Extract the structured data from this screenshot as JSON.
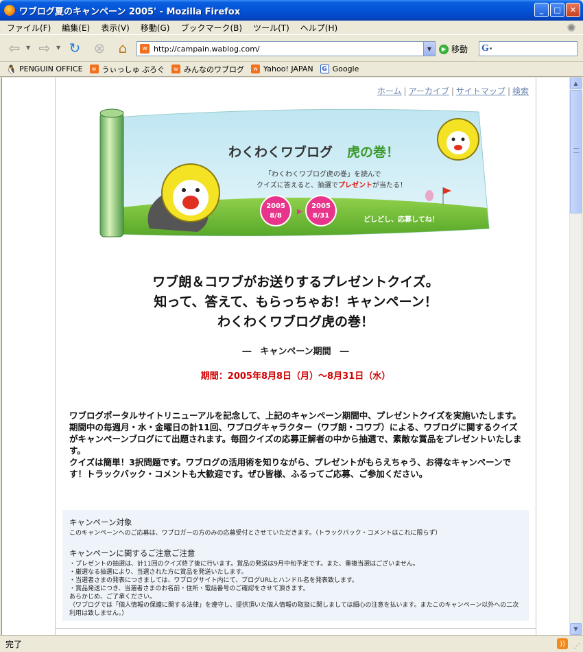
{
  "window": {
    "title": "ワブログ夏のキャンペーン 2005' - Mozilla Firefox",
    "minimize": "_",
    "maximize": "□",
    "close": "✕"
  },
  "menu": {
    "file": "ファイル(F)",
    "edit": "編集(E)",
    "view": "表示(V)",
    "go": "移動(G)",
    "bookmarks": "ブックマーク(B)",
    "tools": "ツール(T)",
    "help": "ヘルプ(H)"
  },
  "nav": {
    "url": "http://campain.wablog.com/",
    "go_label": "移動"
  },
  "bookmarks": [
    {
      "label": "PENGUIN OFFICE"
    },
    {
      "label": "うぃっしゅ ぶろぐ"
    },
    {
      "label": "みんなのワブログ"
    },
    {
      "label": "Yahoo! JAPAN"
    },
    {
      "label": "Google"
    }
  ],
  "toplinks": {
    "home": "ホーム",
    "archive": "アーカイブ",
    "sitemap": "サイトマップ",
    "search": "検索"
  },
  "banner": {
    "title_main": "わくわくワブログ",
    "title_accent": "虎の巻！",
    "desc_line1": "「わくわくワブログ虎の巻」を読んで",
    "desc_line2": "クイズに答えると、抽選で",
    "desc_present": "プレゼント",
    "desc_line2_end": "が当たる！",
    "start_year": "2005",
    "start_date": "8/8",
    "end_year": "2005",
    "end_date": "8/31",
    "tagline": "どしどし、応募してね！"
  },
  "headline": {
    "line1": "ワブ朗＆コワブがお送りするプレゼントクイズ。",
    "line2": "知って、答えて、もらっちゃお！キャンペーン！",
    "line3": "わくわくワブログ虎の巻！"
  },
  "period": {
    "title": "―　キャンペーン期間　―",
    "date": "期間：2005年8月8日（月）～8月31日（水）"
  },
  "intro": {
    "p1": "ワブログポータルサイトリニューアルを記念して、上記のキャンペーン期間中、プレゼントクイズを実施いたします。",
    "p2": "期間中の毎週月・水・金曜日の計11回、ワブログキャラクター（ワブ朗・コワブ）による、ワブログに関するクイズがキャンペーンブログにて出題されます。毎回クイズの応募正解者の中から抽選で、素敵な賞品をプレゼントいたします。",
    "p3": "クイズは簡単！3択問題です。ワブログの活用術を知りながら、プレゼントがもらえちゃう、お得なキャンペーンです！トラックバック・コメントも大歓迎です。ぜひ皆様、ふるってご応募、ご参加ください。"
  },
  "notice": {
    "target_title": "キャンペーン対象",
    "target_text": "このキャンペーンへのご応募は、ワブロガーの方のみの応募受付とさせていただきます。（トラックバック・コメントはこれに限らず）",
    "caution_title": "キャンペーンに関するご注意ご注意",
    "caution_lines": [
      "・プレゼントの抽選は、計11回のクイズ終了後に行います。賞品の発送は9月中旬予定です。また、重複当選はございません。",
      "・厳選なる抽選により、当選された方に賞品を発送いたします。",
      "・当選者さまの発表につきましては、ワブログサイト内にて、ブログURLとハンドル名を発表致します。",
      "・賞品発送につき、当選者さまのお名前・住所・電話番号のご確認をさせて頂きます。",
      "あらかじめ、ご了承ください。",
      "（ワブログでは「個人情報の保護に関する法律」を遵守し、提供頂いた個人情報の取扱に関しましては細心の注意を払います。またこのキャンペーン以外への二次利用は致しません。）"
    ]
  },
  "status": {
    "text": "完了"
  },
  "colors": {
    "accent_red": "#d00000",
    "link": "#6b85b0",
    "notice_bg": "#eef4fa"
  }
}
